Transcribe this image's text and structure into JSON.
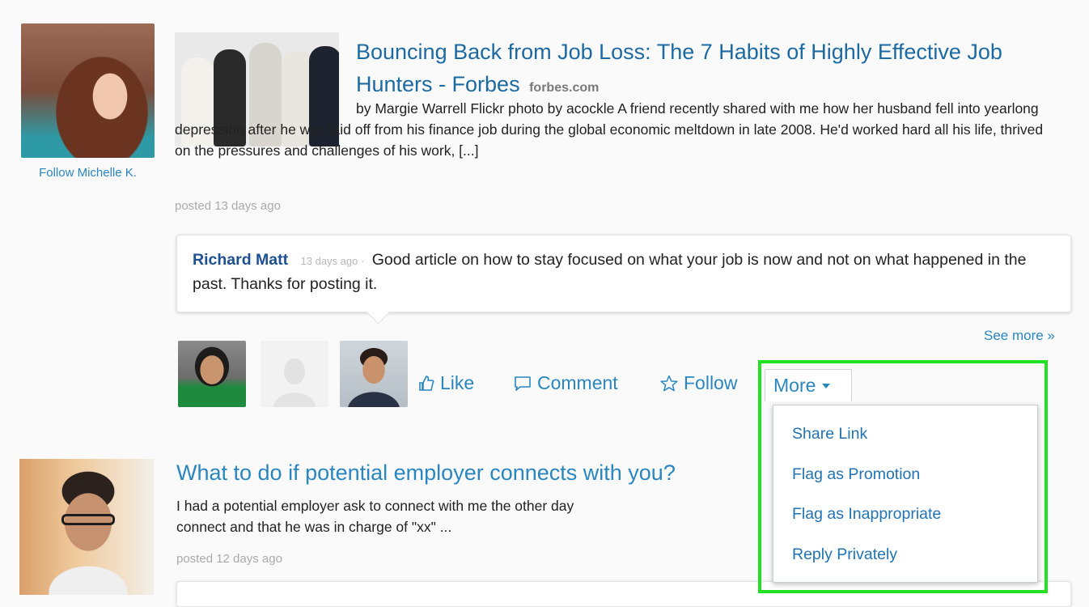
{
  "posts": [
    {
      "author_follow": "Follow Michelle K.",
      "title": "Bouncing Back from Job Loss: The 7 Habits of Highly Effective Job Hunters - Forbes",
      "source": "forbes.com",
      "snippet": "by Margie Warrell Flickr photo by acockle A friend recently shared with me how her husband fell into yearlong depression after he was laid off from his finance job during the global economic meltdown in late 2008. He'd worked hard all his life, thrived on the pressures and challenges of his work, [...]",
      "posted": "posted 13 days ago",
      "comment": {
        "author": "Richard Matt",
        "time": "13 days ago",
        "separator": "·",
        "text": "Good article on how to stay focused on what your job is now and not on what happened in the past. Thanks for posting it."
      },
      "see_more": "See more »",
      "actions": {
        "like": "Like",
        "comment": "Comment",
        "follow": "Follow",
        "more": "More"
      },
      "more_menu": [
        "Share Link",
        "Flag as Promotion",
        "Flag as Inappropriate",
        "Reply Privately"
      ]
    },
    {
      "title": "What to do if potential employer connects with you?",
      "snippet_line1": "I had a potential employer ask to connect with me the other day",
      "snippet_line2": "connect and that he was in charge of \"xx\" ...",
      "posted": "posted 12 days ago"
    }
  ],
  "colors": {
    "link": "#2a86c0",
    "commenter": "#1d4f91",
    "highlight": "#22e022"
  },
  "icons": [
    "like-icon",
    "comment-icon",
    "star-icon",
    "caret-down-icon"
  ]
}
